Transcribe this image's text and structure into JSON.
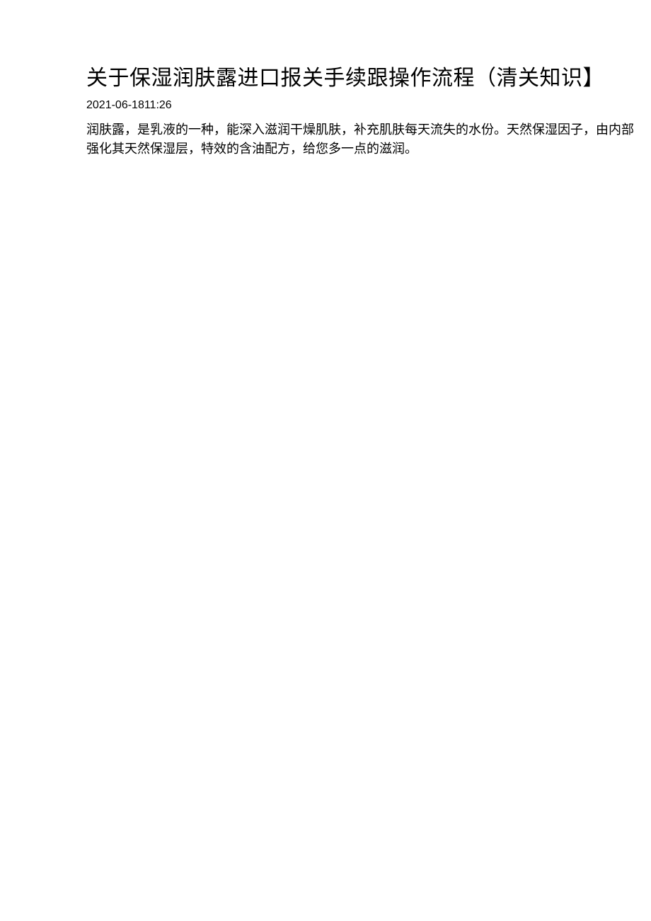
{
  "article": {
    "title": "关于保湿润肤露进口报关手续跟操作流程（清关知识】",
    "timestamp": "2021-06-1811:26",
    "body": "润肤露，是乳液的一种，能深入滋润干燥肌肤，补充肌肤每天流失的水份。天然保湿因子，由内部强化其天然保湿层，特效的含油配方，给您多一点的滋润。"
  }
}
